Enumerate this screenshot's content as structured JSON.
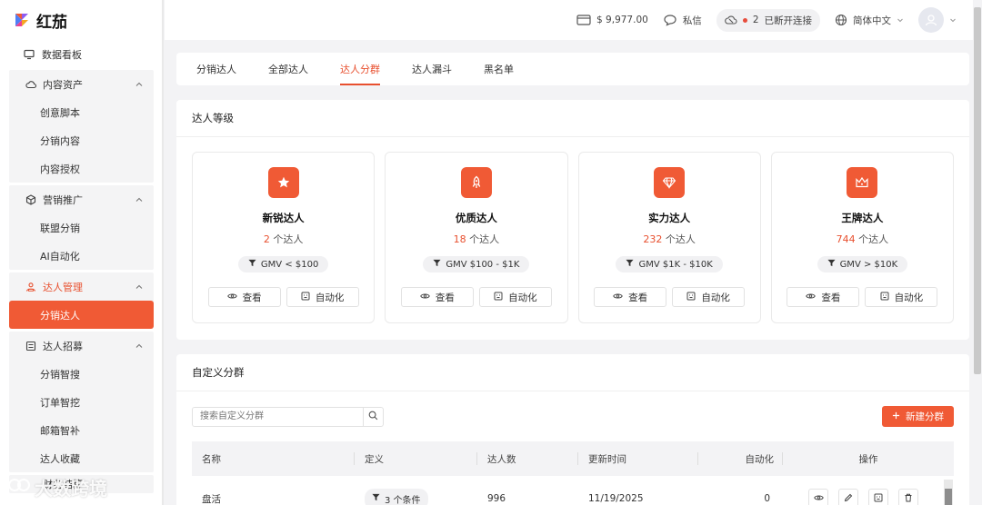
{
  "app": {
    "name": "红茄"
  },
  "sidebar": {
    "dashboard": "数据看板",
    "groups": [
      {
        "label": "内容资产",
        "items": [
          "创意脚本",
          "分销内容",
          "内容授权"
        ]
      },
      {
        "label": "营销推广",
        "items": [
          "联盟分销",
          "AI自动化"
        ]
      },
      {
        "label": "达人管理",
        "items": [
          "分销达人"
        ],
        "active_item": "分销达人"
      },
      {
        "label": "达人招募",
        "items": [
          "分销智搜",
          "订单智挖",
          "邮箱智补",
          "达人收藏"
        ]
      }
    ],
    "partial_group": "财务结算"
  },
  "topbar": {
    "balance": "$ 9,977.00",
    "messages": "私信",
    "connection_count": "2",
    "connection_label": "已断开连接",
    "language": "简体中文"
  },
  "tabs": [
    "分销达人",
    "全部达人",
    "达人分群",
    "达人漏斗",
    "黑名单"
  ],
  "active_tab": "达人分群",
  "levels_section": {
    "title": "达人等级",
    "levels": [
      {
        "name": "新锐达人",
        "count": "2",
        "unit": "个达人",
        "gmv": "GMV < $100",
        "icon": "star-icon"
      },
      {
        "name": "优质达人",
        "count": "18",
        "unit": "个达人",
        "gmv": "GMV $100 - $1K",
        "icon": "rocket-icon"
      },
      {
        "name": "实力达人",
        "count": "232",
        "unit": "个达人",
        "gmv": "GMV $1K - $10K",
        "icon": "diamond-icon"
      },
      {
        "name": "王牌达人",
        "count": "744",
        "unit": "个达人",
        "gmv": "GMV > $10K",
        "icon": "crown-icon"
      }
    ],
    "view_label": "查看",
    "auto_label": "自动化"
  },
  "custom_section": {
    "title": "自定义分群",
    "search_placeholder": "搜索自定义分群",
    "new_button": "新建分群",
    "columns": [
      "名称",
      "定义",
      "达人数",
      "更新时间",
      "自动化",
      "操作"
    ],
    "rows": [
      {
        "name": "盘活",
        "definition": "3 个条件",
        "count": "996",
        "updated": "11/19/2025",
        "automation": "0"
      }
    ]
  },
  "watermark": "大数跨境",
  "colors": {
    "accent": "#f05a35",
    "accent_text": "#e8502f"
  }
}
